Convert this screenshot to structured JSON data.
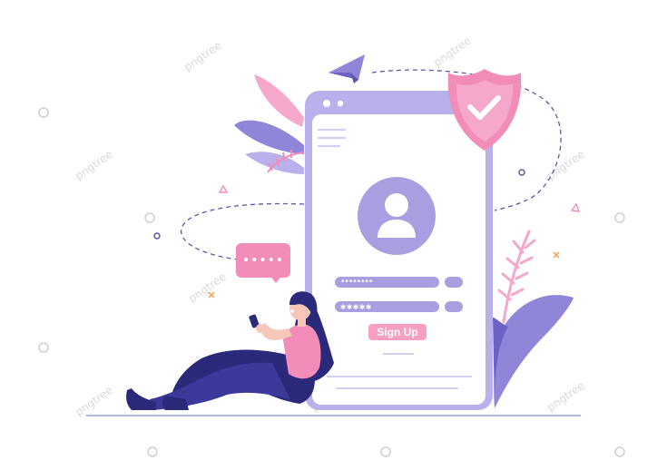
{
  "form": {
    "username_mask": "••••••••",
    "password_mask": "✱✱✱✱✱",
    "signup_label": "Sign Up"
  },
  "chat": {
    "text": "•••••"
  },
  "watermark": {
    "text": "pngtree"
  },
  "icons": {
    "avatar": "user-avatar-icon",
    "shield": "shield-check-icon",
    "plane": "paper-plane-icon",
    "menu": "hamburger-menu-icon"
  },
  "colors": {
    "lavender": "#b9b1ec",
    "purple": "#8f85d9",
    "pink": "#f28cb8",
    "navy": "#2b2a7a"
  }
}
